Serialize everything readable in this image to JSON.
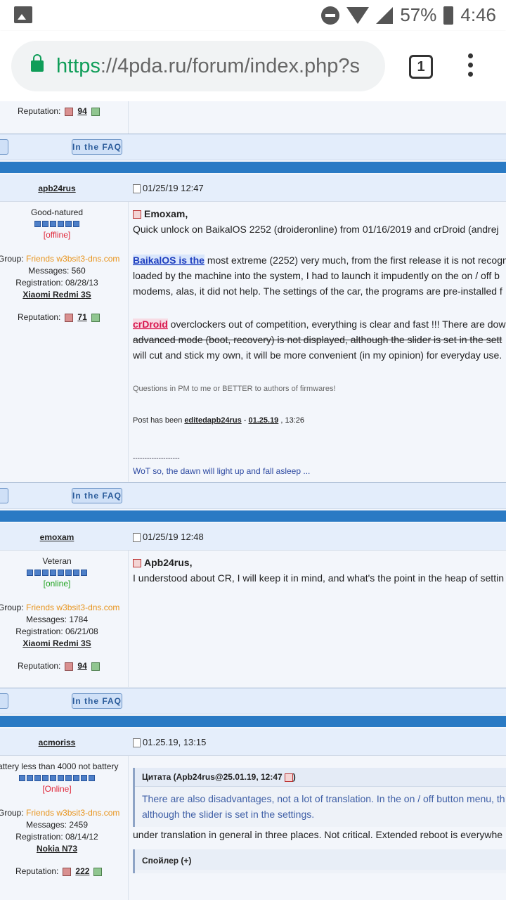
{
  "statusbar": {
    "battery": "57%",
    "time": "4:46"
  },
  "browser": {
    "url_proto": "https",
    "url_rest": "://4pda.ru/forum/index.php?s",
    "tab_count": "1"
  },
  "top_reputation": {
    "label": "Reputation:",
    "value": "94"
  },
  "faq_label": "In the FAQ",
  "posts": [
    {
      "user": "apb24rus",
      "date": "01/25/19 12:47",
      "rank": "Good-natured",
      "status": "[offline]",
      "group_label": "Group:",
      "group": "Friends w3bsit3-dns.com",
      "messages": "Messages: 560",
      "registration": "Registration: 08/28/13",
      "device": "Xiaomi Redmi 3S",
      "reputation_label": "Reputation:",
      "reputation": "71",
      "reply_to": "Emoxam,",
      "line1": "Quick unlock on BaikalOS 2252 (droideronline) from 01/16/2019 and crDroid (andrej",
      "link1": "BaikalOS is the",
      "line2": " most extreme (2252) very much, from the first release it is not recogn",
      "line3": "loaded by the machine into the system, I had to launch it impudently on the on / off b",
      "line4": "modems, alas, it did not help. The settings of the car, the programs are pre-installed f",
      "link2": "crDroid",
      "line5": " overclockers out of competition, everything is clear and fast !!! There are dow",
      "line6_strike": "advanced mode (boot, recovery) is not displayed, although the slider is set in the sett",
      "line7": "will cut and stick my own, it will be more convenient (in my opinion) for everyday use.",
      "note": "Questions in PM to me or BETTER to authors of firmwares!",
      "edited_prefix": "Post has been ",
      "edited_link": "editedapb24rus",
      "edited_sep": " - ",
      "edited_date": "01.25.19",
      "edited_time": " , 13:26",
      "sig_dashes": "--------------------",
      "sig_text": "WoT so, the dawn will light up and fall asleep ..."
    },
    {
      "user": "emoxam",
      "date": "01/25/19 12:48",
      "rank": "Veteran",
      "status": "[online]",
      "group_label": "Group:",
      "group": "Friends w3bsit3-dns.com",
      "messages": "Messages: 1784",
      "registration": "Registration: 06/21/08",
      "device": "Xiaomi Redmi 3S",
      "reputation_label": "Reputation:",
      "reputation": "94",
      "reply_to": "Apb24rus,",
      "line1": "I understood about CR, I will keep it in mind, and what's the point in the heap of settin"
    },
    {
      "user": "acmoriss",
      "date": "01.25.19, 13:15",
      "rank": "attery less than 4000 not battery",
      "status": "[Online]",
      "group_label": "Group:",
      "group": "Friends w3bsit3-dns.com",
      "messages": "Messages: 2459",
      "registration": "Registration: 08/14/12",
      "device": "Nokia N73",
      "reputation_label": "Reputation:",
      "reputation": "222",
      "quote_head": "Цитата (Apb24rus@25.01.19, 12:47",
      "quote_head_end": ")",
      "quote_line1": "There are also disadvantages, not a lot of translation. In the on / off button menu, th",
      "quote_line2": "although the slider is set in the settings.",
      "line1": "under translation in general in three places. Not critical. Extended reboot is everywhe",
      "spoiler": "Спойлер (+)"
    }
  ]
}
